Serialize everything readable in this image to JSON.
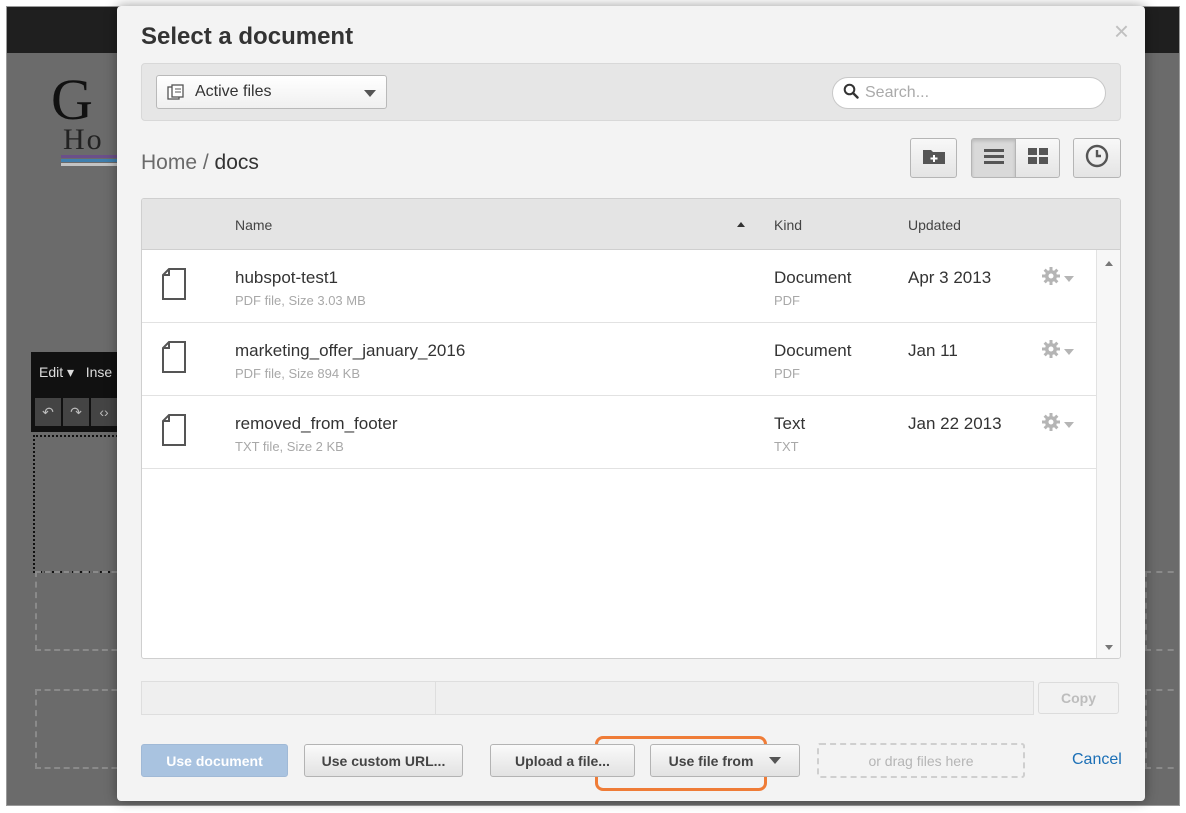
{
  "background": {
    "logo": {
      "big": "G",
      "small": "Ho"
    },
    "editor": {
      "menu_edit": "Edit ▾",
      "menu_insert": "Inse"
    }
  },
  "modal": {
    "title": "Select a document",
    "close_glyph": "×",
    "filter": {
      "selected": "Active files",
      "search_placeholder": "Search..."
    },
    "breadcrumb": {
      "home": "Home",
      "separator": " / ",
      "current": "docs"
    },
    "toolbar_icons": [
      "new-folder-icon",
      "list-view-icon",
      "grid-view-icon",
      "clock-icon"
    ],
    "table": {
      "headers": {
        "name": "Name",
        "kind": "Kind",
        "updated": "Updated"
      },
      "rows": [
        {
          "name": "hubspot-test1",
          "meta": "PDF file, Size 3.03 MB",
          "kind": "Document",
          "ext": "PDF",
          "updated": "Apr 3 2013"
        },
        {
          "name": "marketing_offer_january_2016",
          "meta": "PDF file, Size 894 KB",
          "kind": "Document",
          "ext": "PDF",
          "updated": "Jan 11"
        },
        {
          "name": "removed_from_footer",
          "meta": "TXT file, Size 2 KB",
          "kind": "Text",
          "ext": "TXT",
          "updated": "Jan 22 2013"
        }
      ]
    },
    "copy_label": "Copy",
    "footer": {
      "use_document": "Use document",
      "use_custom_url": "Use custom URL...",
      "upload": "Upload a file...",
      "use_file_from": "Use file from",
      "drag_hint": "or drag files here",
      "cancel": "Cancel"
    },
    "colors": {
      "accent_link": "#1b6fb6",
      "highlight": "#ef7c37",
      "primary_disabled": "#a9c3e0"
    }
  }
}
